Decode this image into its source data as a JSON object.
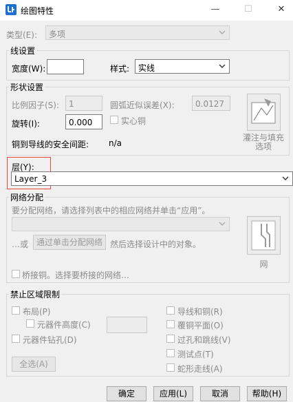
{
  "window": {
    "title": "绘图特性",
    "minimize": "—",
    "maximize": "☐",
    "close": "✕"
  },
  "type": {
    "label": "类型(E):",
    "value": "多项"
  },
  "line": {
    "group": "线设置",
    "width_label": "宽度(W):",
    "width_value": "",
    "style_label": "样式:",
    "style_value": "实线"
  },
  "shape": {
    "group": "形状设置",
    "scale_label": "比例因子(S):",
    "scale_value": "1",
    "arc_label": "圆弧近似误差(X):",
    "arc_value": "0.0127",
    "rotate_label": "旋转(I):",
    "rotate_value": "0.000",
    "solid_copper": "实心铜",
    "clearance_label": "铜到导线的安全间距:",
    "clearance_value": "n/a",
    "fill_btn": "灌注与填充选项"
  },
  "layer": {
    "label": "层(Y):",
    "value": "Layer_3"
  },
  "net": {
    "group": "网络分配",
    "hint": "要分配网络，请选择列表中的相应网络并单击“应用”。",
    "or_text": "…或",
    "assign_btn": "通过单击分配网络",
    "then_text": "然后选择设计中的对象。",
    "net_btn": "网",
    "bridge": "桥接铜。选择要桥接的网络…"
  },
  "keepout": {
    "group": "禁止区域限制",
    "placement": "布局(P)",
    "component_height": "元器件高度(C)",
    "component_drill": "元器件钻孔(D)",
    "select_all": "全选(A)",
    "traces_copper": "导线和铜(R)",
    "copper_plane": "覆铜平面(O)",
    "vias_jumpers": "过孔和跳线(V)",
    "test_points": "测试点(T)",
    "serpentine": "蛇形走线(A)"
  },
  "buttons": {
    "ok": "确定",
    "apply": "应用(L)",
    "cancel": "取消",
    "help": "帮助(H)"
  },
  "colors": {
    "highlight": "#e8473a",
    "app_icon": "#1f6fd1"
  }
}
